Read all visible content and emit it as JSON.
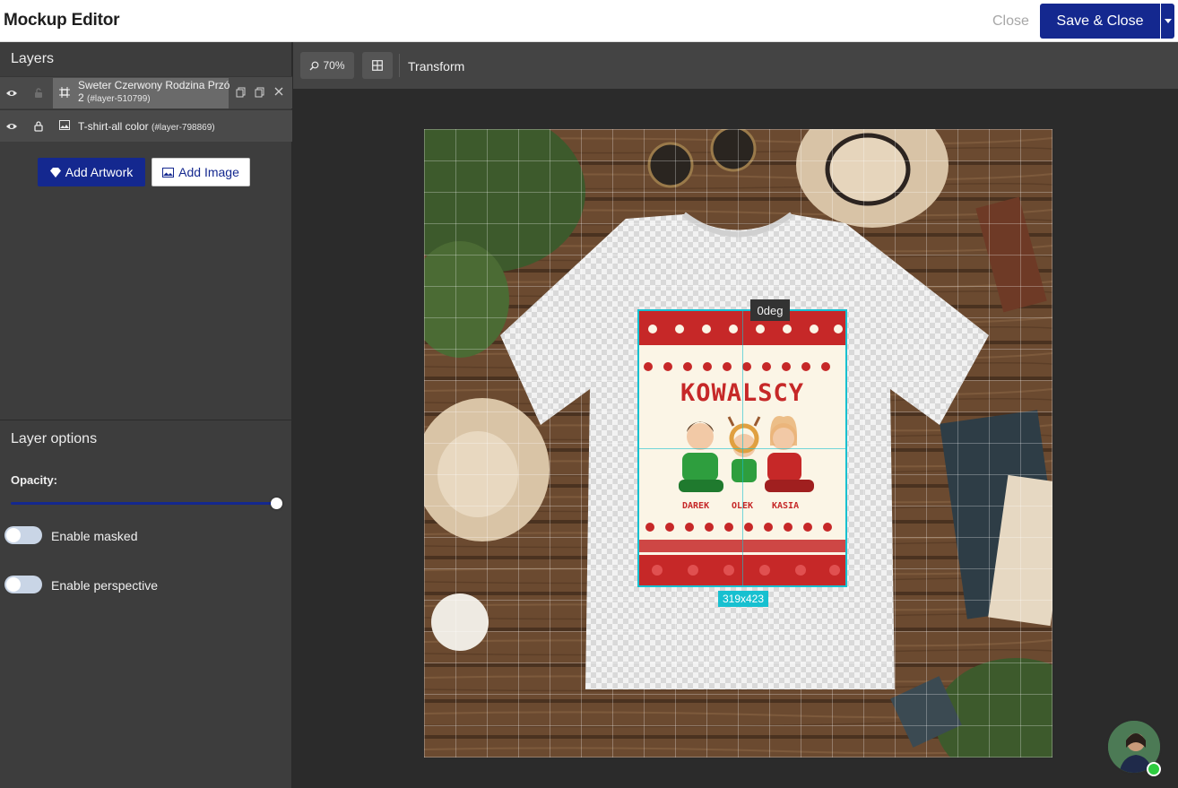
{
  "header": {
    "title": "Mockup Editor",
    "close_label": "Close",
    "save_label": "Save & Close"
  },
  "layers_panel": {
    "title": "Layers",
    "layers": [
      {
        "name_line1": "Sweter Czerwony Rodzina Przó",
        "name_line2": "2",
        "id": "(#layer-510799)",
        "type_icon": "artwork-icon",
        "selected": true
      },
      {
        "name_line1": "T-shirt-all color",
        "id": "(#layer-798869)",
        "type_icon": "image-icon",
        "selected": false
      }
    ],
    "add_artwork_label": "Add Artwork",
    "add_image_label": "Add Image"
  },
  "layer_options": {
    "title": "Layer options",
    "opacity_label": "Opacity:",
    "opacity_value": 1.0,
    "enable_masked_label": "Enable masked",
    "enable_masked": false,
    "enable_perspective_label": "Enable perspective",
    "enable_perspective": false
  },
  "toolbar": {
    "zoom_label": "70%",
    "transform_label": "Transform"
  },
  "canvas": {
    "rotation_label": "0deg",
    "size_label": "319x423",
    "artwork": {
      "title": "KOWALSCY",
      "names": [
        "DAREK",
        "OLEK",
        "KASIA"
      ]
    }
  },
  "colors": {
    "primary": "#14288f",
    "selection": "#17c0d0",
    "artwork_red": "#c62828",
    "artwork_green": "#2e9e3e"
  }
}
